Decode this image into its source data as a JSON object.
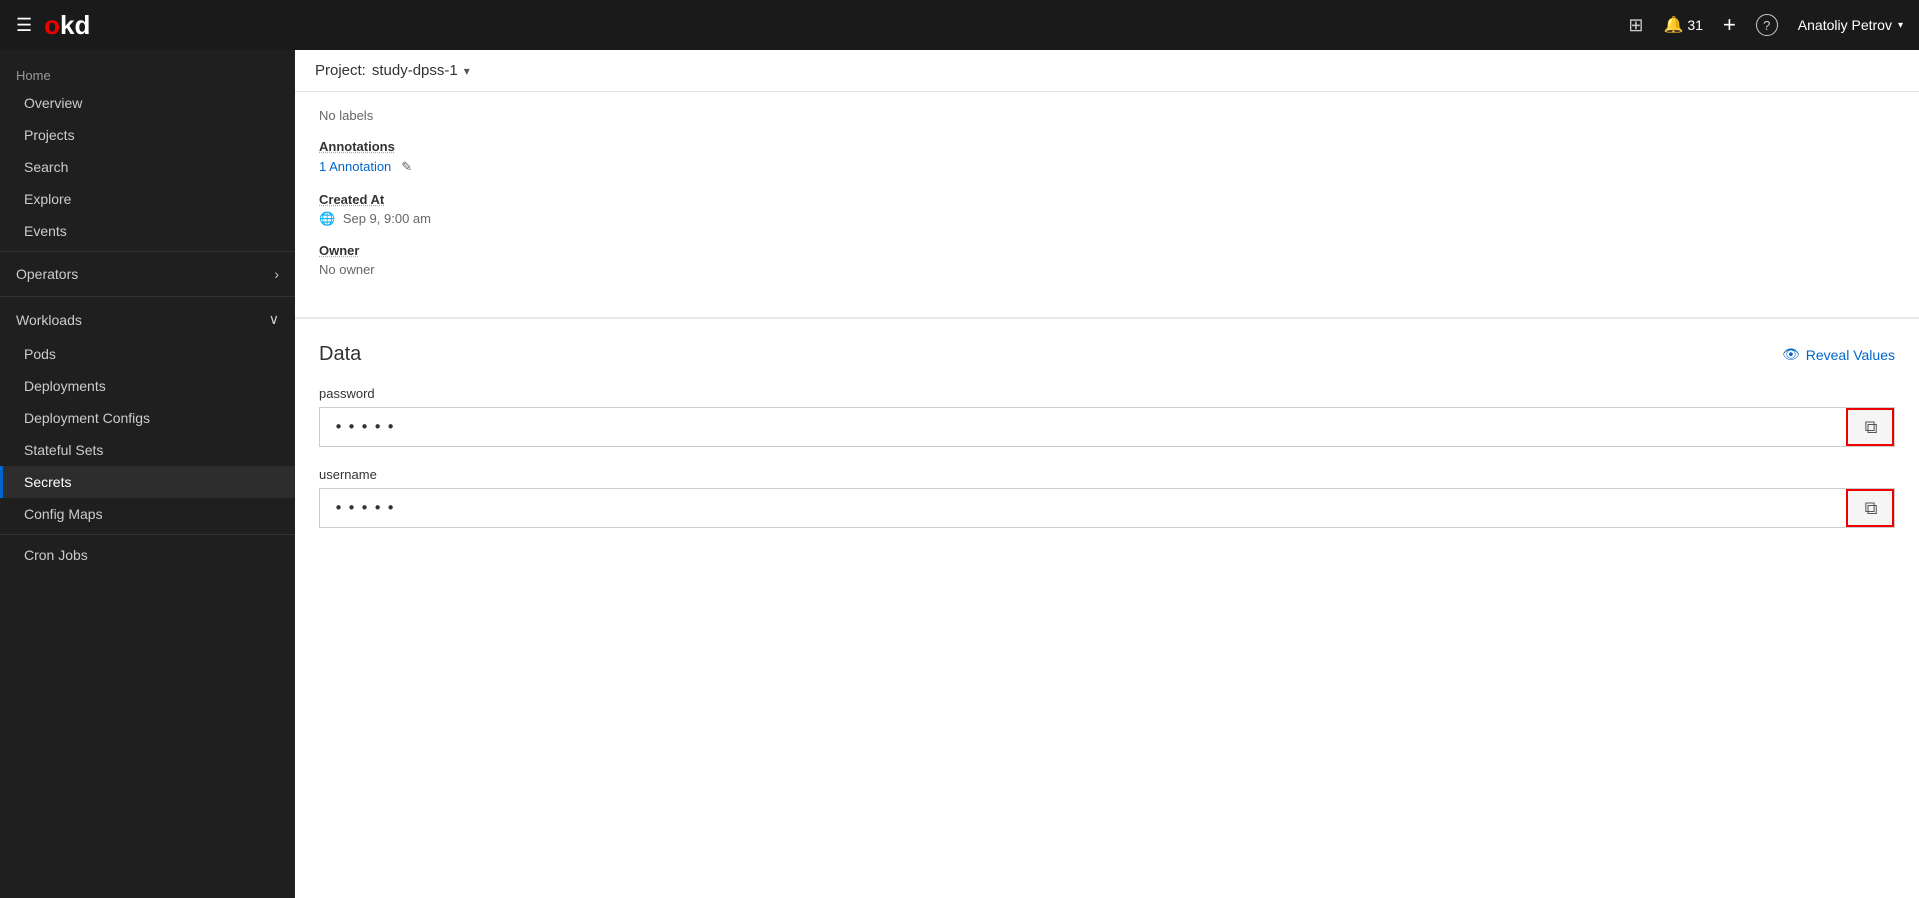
{
  "topnav": {
    "logo": "okd",
    "logo_o": "o",
    "logo_kd": "kd",
    "grid_icon": "⊞",
    "bell_icon": "🔔",
    "notification_count": "31",
    "plus_icon": "+",
    "help_icon": "?",
    "user_name": "Anatoliy Petrov",
    "user_chevron": "▾"
  },
  "sidebar": {
    "home_section": "Home",
    "items": [
      {
        "label": "Overview",
        "active": false
      },
      {
        "label": "Projects",
        "active": false
      },
      {
        "label": "Search",
        "active": false
      },
      {
        "label": "Explore",
        "active": false
      },
      {
        "label": "Events",
        "active": false
      }
    ],
    "operators_section": "Operators",
    "operators_chevron": "›",
    "workloads_section": "Workloads",
    "workloads_chevron": "∨",
    "workload_items": [
      {
        "label": "Pods",
        "active": false
      },
      {
        "label": "Deployments",
        "active": false
      },
      {
        "label": "Deployment Configs",
        "active": false
      },
      {
        "label": "Stateful Sets",
        "active": false
      },
      {
        "label": "Secrets",
        "active": true
      },
      {
        "label": "Config Maps",
        "active": false
      },
      {
        "label": "Cron Jobs",
        "active": false
      }
    ]
  },
  "project_bar": {
    "label": "Project:",
    "project_name": "study-dpss-1",
    "chevron": "▾"
  },
  "meta": {
    "labels_label": "No labels",
    "annotations_title": "Annotations",
    "annotations_value": "1 Annotation",
    "annotations_edit_icon": "✎",
    "created_at_title": "Created At",
    "created_at_globe_icon": "🌐",
    "created_at_value": "Sep 9, 9:00 am",
    "owner_title": "Owner",
    "owner_value": "No owner"
  },
  "data_section": {
    "title": "Data",
    "reveal_eye_icon": "👁",
    "reveal_label": "Reveal Values",
    "fields": [
      {
        "label": "password",
        "value": "•••••",
        "copy_icon": "⧉"
      },
      {
        "label": "username",
        "value": "•••••",
        "copy_icon": "⧉"
      }
    ]
  }
}
